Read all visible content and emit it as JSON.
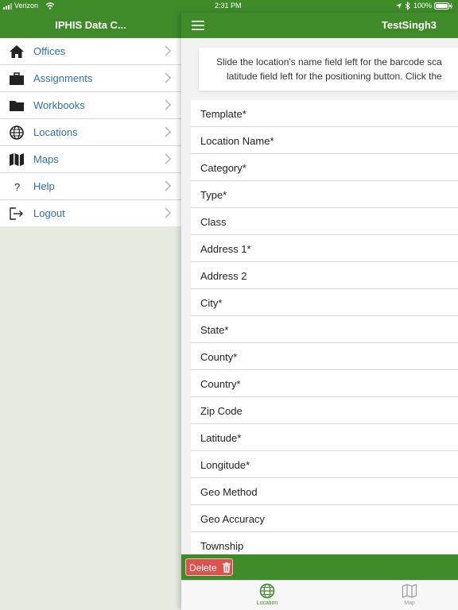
{
  "status_bar": {
    "carrier": "Verizon",
    "time": "2:31 PM",
    "battery": "100%"
  },
  "sidebar": {
    "title": "IPHIS Data C...",
    "items": [
      {
        "label": "Offices",
        "icon": "home-icon"
      },
      {
        "label": "Assignments",
        "icon": "briefcase-icon"
      },
      {
        "label": "Workbooks",
        "icon": "folder-icon"
      },
      {
        "label": "Locations",
        "icon": "globe-icon"
      },
      {
        "label": "Maps",
        "icon": "map-icon"
      },
      {
        "label": "Help",
        "icon": "question-icon"
      },
      {
        "label": "Logout",
        "icon": "logout-icon"
      }
    ]
  },
  "main": {
    "title": "TestSingh3",
    "hint_line_1": "Slide the location's name field left for the barcode sca",
    "hint_line_2": "latitude field left for the positioning button. Click the",
    "fields": [
      "Template*",
      "Location Name*",
      "Category*",
      "Type*",
      "Class",
      "Address 1*",
      "Address 2",
      "City*",
      "State*",
      "County*",
      "Country*",
      "Zip Code",
      "Latitude*",
      "Longitude*",
      "Geo Method",
      "Geo Accuracy",
      "Township"
    ]
  },
  "toolbar": {
    "delete_label": "Delete"
  },
  "tabs": [
    {
      "label": "Location",
      "icon": "globe-icon",
      "active": true
    },
    {
      "label": "Map",
      "icon": "map-icon",
      "active": false
    }
  ],
  "colors": {
    "brand_green": "#3f8b2a",
    "link_blue": "#2f6fa8",
    "delete_red": "#d9534f"
  }
}
